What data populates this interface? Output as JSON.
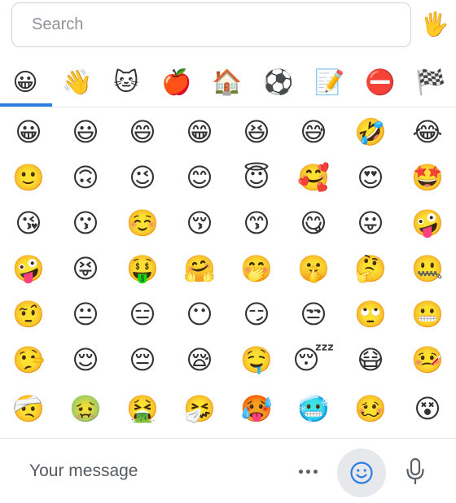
{
  "search": {
    "placeholder": "Search"
  },
  "skin_tone_button": {
    "emoji": "🖐"
  },
  "categories": [
    {
      "name": "smileys",
      "emoji": "😀"
    },
    {
      "name": "people",
      "emoji": "👋"
    },
    {
      "name": "animals",
      "emoji": "🐱"
    },
    {
      "name": "food",
      "emoji": "🍎"
    },
    {
      "name": "travel",
      "emoji": "🏠"
    },
    {
      "name": "activities",
      "emoji": "⚽"
    },
    {
      "name": "objects",
      "emoji": "📝"
    },
    {
      "name": "symbols",
      "emoji": "⛔"
    },
    {
      "name": "flags",
      "emoji": "🏁"
    }
  ],
  "active_category": "smileys",
  "emoji_grid": [
    [
      "😀",
      "😃",
      "😄",
      "😁",
      "😆",
      "😅",
      "🤣",
      "😂"
    ],
    [
      "🙂",
      "🙃",
      "😉",
      "😊",
      "😇",
      "🥰",
      "😍",
      "🤩"
    ],
    [
      "😘",
      "😗",
      "☺️",
      "😚",
      "😙",
      "😋",
      "😛",
      "🤪"
    ],
    [
      "🤪",
      "😝",
      "🤑",
      "🤗",
      "🤭",
      "🤫",
      "🤔",
      "🤐"
    ],
    [
      "🤨",
      "😐",
      "😑",
      "😶",
      "😏",
      "😒",
      "🙄",
      "😬"
    ],
    [
      "🤥",
      "😌",
      "😔",
      "😪",
      "🤤",
      "😴",
      "😷",
      "🤒"
    ],
    [
      "🤕",
      "🤢",
      "🤮",
      "🤧",
      "🥵",
      "🥶",
      "🥴",
      "😵"
    ]
  ],
  "message": {
    "placeholder": "Your message"
  },
  "accent_color": "#2a7de1"
}
